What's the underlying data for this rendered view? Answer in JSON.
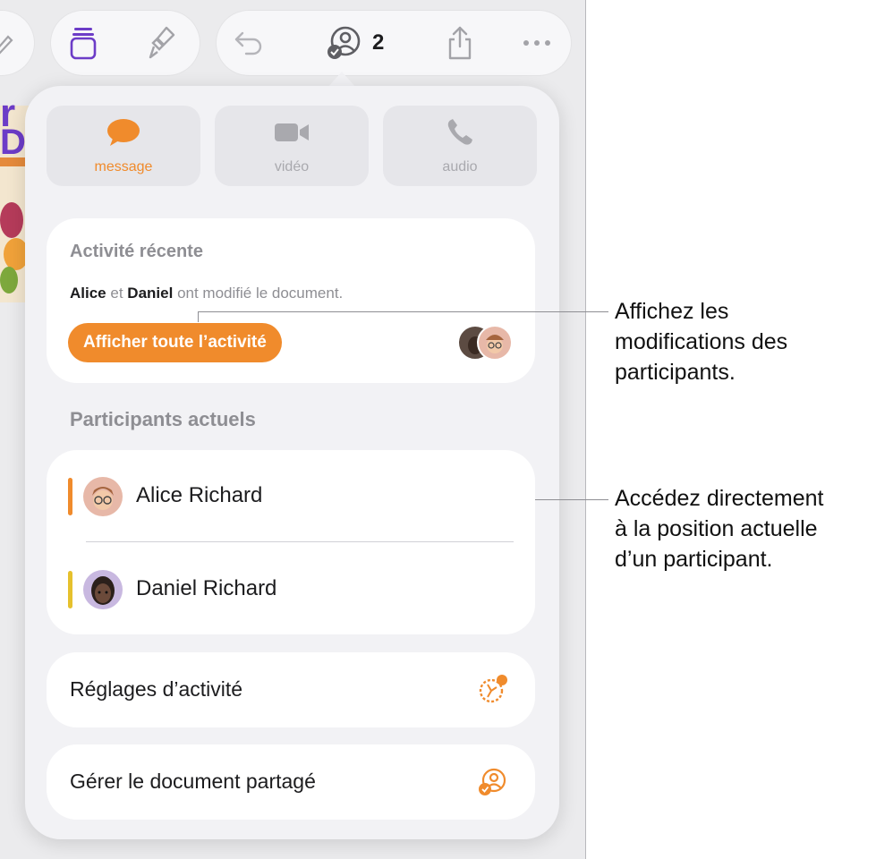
{
  "toolbar": {
    "collaborator_count": "2"
  },
  "popover": {
    "communication": [
      {
        "label": "message"
      },
      {
        "label": "vidéo"
      },
      {
        "label": "audio"
      }
    ],
    "recent_activity": {
      "title": "Activité récente",
      "name1": "Alice",
      "conj": "et",
      "name2": "Daniel",
      "suffix": "ont modifié le document.",
      "button_label": "Afficher toute l’activité"
    },
    "participants": {
      "title": "Participants actuels",
      "people": [
        {
          "name": "Alice Richard",
          "color": "#f08b2c"
        },
        {
          "name": "Daniel Richard",
          "color": "#e6c12d"
        }
      ]
    },
    "activity_settings_label": "Réglages d’activité",
    "manage_label": "Gérer le document partagé"
  },
  "callouts": {
    "changes": "Affichez les\nmodifications des\nparticipants.",
    "position": "Accédez directement\nà la position actuelle\nd’un participant."
  },
  "colors": {
    "accent": "#f08b2c",
    "daniel_bar": "#e6c12d"
  }
}
